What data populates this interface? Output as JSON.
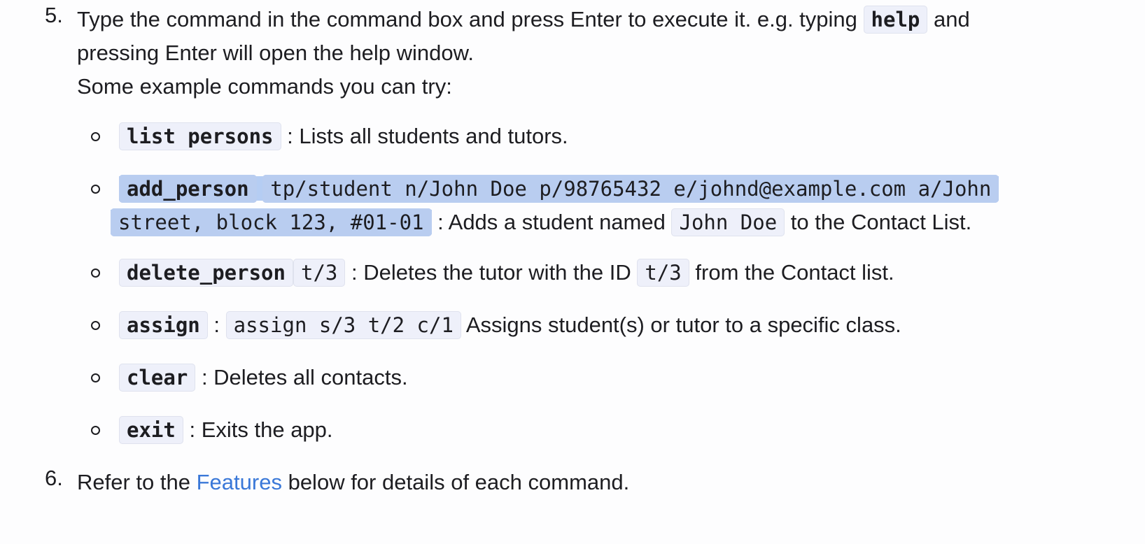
{
  "steps": [
    {
      "number": "5.",
      "line1_text": "Type the command in the command box and press Enter to execute it. e.g. typing",
      "line1_code": "help",
      "line1_after": "and",
      "line2": "pressing Enter will open the help window.",
      "line3": "Some example commands you can try:"
    },
    {
      "number": "6.",
      "before_link": "Refer to the",
      "link": "Features",
      "after_link": "below for details of each command."
    }
  ],
  "examples": {
    "list": {
      "code": "list persons",
      "desc": ": Lists all students and tutors."
    },
    "add": {
      "code": "add_person",
      "args_line1": "tp/student n/John Doe p/98765432 e/johnd@example.com a/John",
      "args_line2": "street, block 123, #01-01",
      "desc_before": ": Adds a student named",
      "name_code": "John Doe",
      "desc_after": "to the Contact List."
    },
    "delete": {
      "code": "delete_person",
      "arg": "t/3",
      "desc_before": ": Deletes the tutor with the ID",
      "id_code": "t/3",
      "desc_after": "from the Contact list."
    },
    "assign": {
      "code": "assign",
      "sep": ":",
      "example": "assign s/3 t/2 c/1",
      "desc": "Assigns student(s) or tutor to a specific class."
    },
    "clear": {
      "code": "clear",
      "desc": ": Deletes all contacts."
    },
    "exit": {
      "code": "exit",
      "desc": ": Exits the app."
    }
  }
}
